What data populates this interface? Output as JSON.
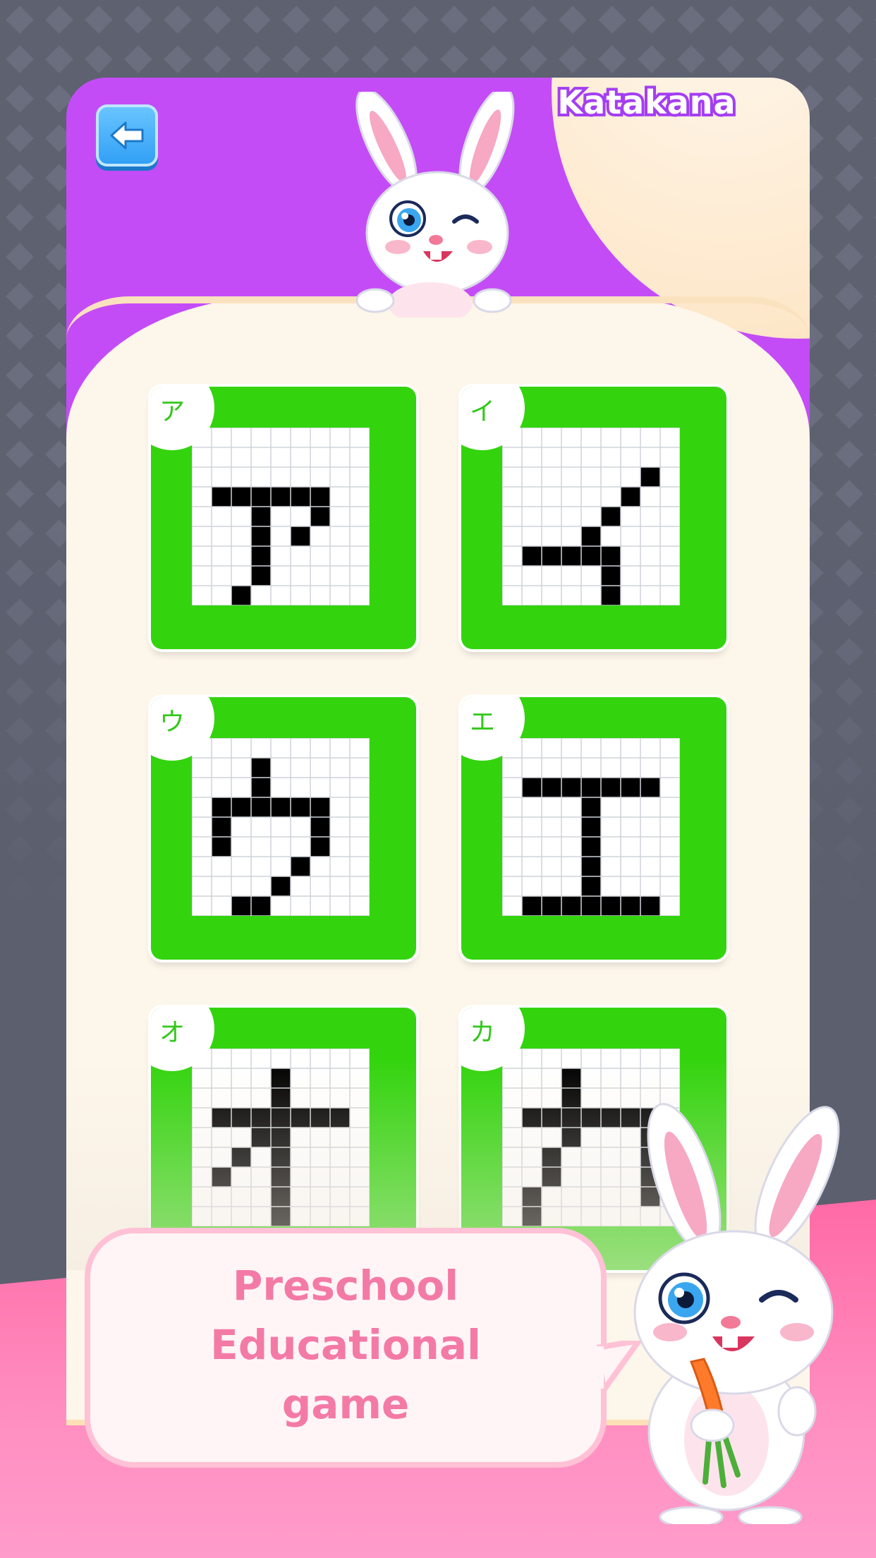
{
  "header": {
    "title": "Katakana",
    "back_label": "back"
  },
  "cards": [
    {
      "kana": "ア",
      "cells": [
        [
          1,
          3
        ],
        [
          2,
          3
        ],
        [
          3,
          3
        ],
        [
          4,
          3
        ],
        [
          5,
          3
        ],
        [
          6,
          3
        ],
        [
          6,
          4
        ],
        [
          5,
          5
        ],
        [
          3,
          4
        ],
        [
          3,
          5
        ],
        [
          3,
          6
        ],
        [
          3,
          7
        ],
        [
          2,
          8
        ]
      ]
    },
    {
      "kana": "イ",
      "cells": [
        [
          7,
          2
        ],
        [
          6,
          3
        ],
        [
          5,
          4
        ],
        [
          4,
          5
        ],
        [
          1,
          6
        ],
        [
          2,
          6
        ],
        [
          3,
          6
        ],
        [
          4,
          6
        ],
        [
          5,
          6
        ],
        [
          5,
          7
        ],
        [
          5,
          8
        ]
      ]
    },
    {
      "kana": "ウ",
      "cells": [
        [
          3,
          1
        ],
        [
          3,
          2
        ],
        [
          1,
          3
        ],
        [
          2,
          3
        ],
        [
          3,
          3
        ],
        [
          4,
          3
        ],
        [
          5,
          3
        ],
        [
          6,
          3
        ],
        [
          1,
          4
        ],
        [
          6,
          4
        ],
        [
          1,
          5
        ],
        [
          6,
          5
        ],
        [
          5,
          6
        ],
        [
          4,
          7
        ],
        [
          3,
          8
        ],
        [
          2,
          8
        ]
      ]
    },
    {
      "kana": "エ",
      "cells": [
        [
          1,
          2
        ],
        [
          2,
          2
        ],
        [
          3,
          2
        ],
        [
          4,
          2
        ],
        [
          5,
          2
        ],
        [
          6,
          2
        ],
        [
          7,
          2
        ],
        [
          4,
          3
        ],
        [
          4,
          4
        ],
        [
          4,
          5
        ],
        [
          4,
          6
        ],
        [
          4,
          7
        ],
        [
          1,
          8
        ],
        [
          2,
          8
        ],
        [
          3,
          8
        ],
        [
          4,
          8
        ],
        [
          5,
          8
        ],
        [
          6,
          8
        ],
        [
          7,
          8
        ]
      ]
    },
    {
      "kana": "オ",
      "cells": [
        [
          4,
          1
        ],
        [
          4,
          2
        ],
        [
          1,
          3
        ],
        [
          2,
          3
        ],
        [
          3,
          3
        ],
        [
          4,
          3
        ],
        [
          5,
          3
        ],
        [
          6,
          3
        ],
        [
          7,
          3
        ],
        [
          3,
          4
        ],
        [
          4,
          4
        ],
        [
          2,
          5
        ],
        [
          4,
          5
        ],
        [
          1,
          6
        ],
        [
          4,
          6
        ],
        [
          4,
          7
        ],
        [
          4,
          8
        ]
      ]
    },
    {
      "kana": "カ",
      "cells": [
        [
          3,
          1
        ],
        [
          3,
          2
        ],
        [
          1,
          3
        ],
        [
          2,
          3
        ],
        [
          3,
          3
        ],
        [
          4,
          3
        ],
        [
          5,
          3
        ],
        [
          6,
          3
        ],
        [
          7,
          3
        ],
        [
          3,
          4
        ],
        [
          7,
          4
        ],
        [
          2,
          5
        ],
        [
          7,
          5
        ],
        [
          2,
          6
        ],
        [
          7,
          6
        ],
        [
          1,
          7
        ],
        [
          7,
          7
        ],
        [
          1,
          8
        ]
      ]
    }
  ],
  "promo": {
    "line1": "Preschool",
    "line2": "Educational",
    "line3": "game"
  },
  "colors": {
    "panel": "#c44cf6",
    "card_green": "#33d40e",
    "back_button": "#2f9ef5",
    "promo_text": "#f47aa6"
  }
}
